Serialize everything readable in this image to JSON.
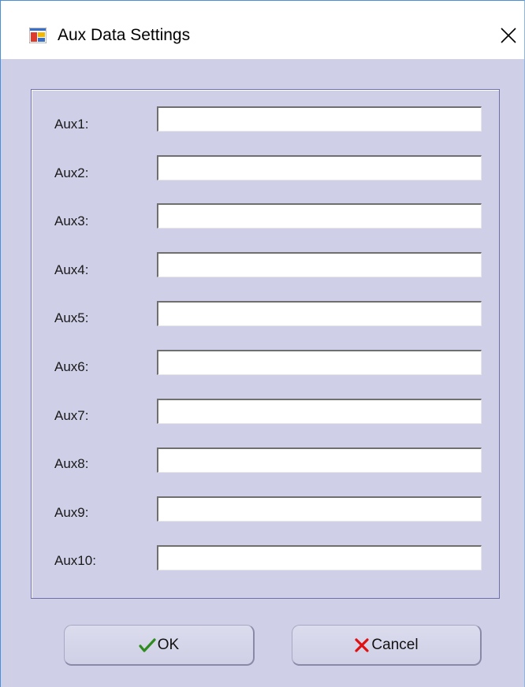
{
  "window": {
    "title": "Aux Data Settings"
  },
  "fields": [
    {
      "label": "Aux1:",
      "value": ""
    },
    {
      "label": "Aux2:",
      "value": ""
    },
    {
      "label": "Aux3:",
      "value": ""
    },
    {
      "label": "Aux4:",
      "value": ""
    },
    {
      "label": "Aux5:",
      "value": ""
    },
    {
      "label": "Aux6:",
      "value": ""
    },
    {
      "label": "Aux7:",
      "value": ""
    },
    {
      "label": "Aux8:",
      "value": ""
    },
    {
      "label": "Aux9:",
      "value": ""
    },
    {
      "label": "Aux10:",
      "value": ""
    }
  ],
  "buttons": {
    "ok_label": "OK",
    "ok_icon": "checkmark-icon",
    "cancel_label": "Cancel",
    "cancel_icon": "x-mark-icon"
  },
  "colors": {
    "dialog_background": "#cfcfe8",
    "ok_check": "#2e8b1e",
    "cancel_x": "#e01010"
  }
}
